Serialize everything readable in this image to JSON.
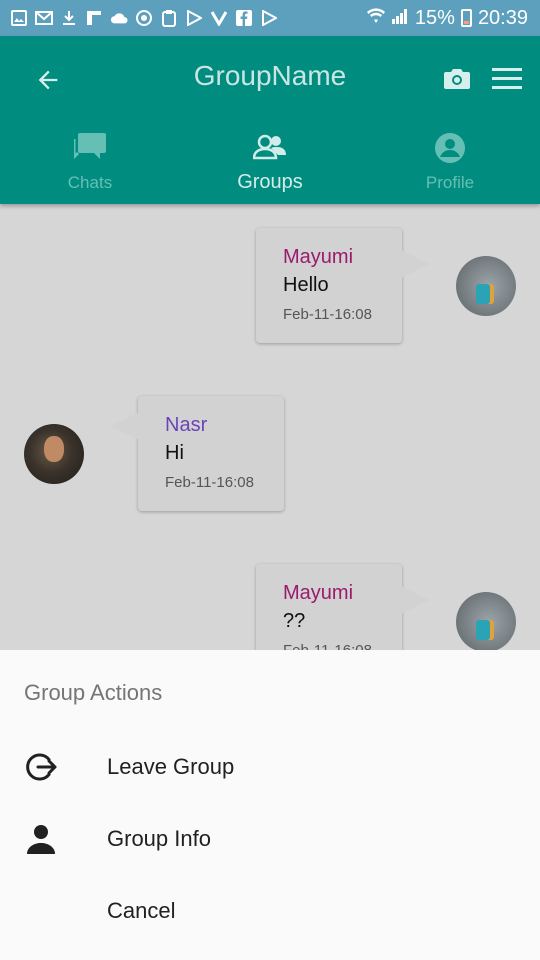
{
  "status_bar": {
    "notification_icons": [
      "gallery-icon",
      "gmail-icon",
      "download-icon",
      "flipboard-icon",
      "cloud-icon",
      "sync-icon",
      "clipboard-icon",
      "play-store-icon",
      "vidmate-icon",
      "facebook-icon",
      "play-store-icon"
    ],
    "battery": "15%",
    "time": "20:39"
  },
  "toolbar": {
    "title": "GroupName",
    "color": "#008d80"
  },
  "tabs": [
    {
      "label": "Chats",
      "icon": "chat-bubbles-icon",
      "active": false
    },
    {
      "label": "Groups",
      "icon": "group-icon",
      "active": true
    },
    {
      "label": "Profile",
      "icon": "account-circle-icon",
      "active": false
    }
  ],
  "messages": [
    {
      "sender": "Mayumi",
      "text": "Hello",
      "time": "Feb-11-16:08",
      "side": "right",
      "sender_color": "#9c1a6d"
    },
    {
      "sender": "Nasr",
      "text": "Hi",
      "time": "Feb-11-16:08",
      "side": "left",
      "sender_color": "#6a45b8"
    },
    {
      "sender": "Mayumi",
      "text": "??",
      "time": "Feb-11-16:08",
      "side": "right",
      "sender_color": "#9c1a6d"
    }
  ],
  "sheet": {
    "title": "Group Actions",
    "actions": [
      {
        "label": "Leave Group",
        "icon": "logout-icon"
      },
      {
        "label": "Group Info",
        "icon": "person-icon"
      },
      {
        "label": "Cancel",
        "icon": ""
      }
    ]
  }
}
